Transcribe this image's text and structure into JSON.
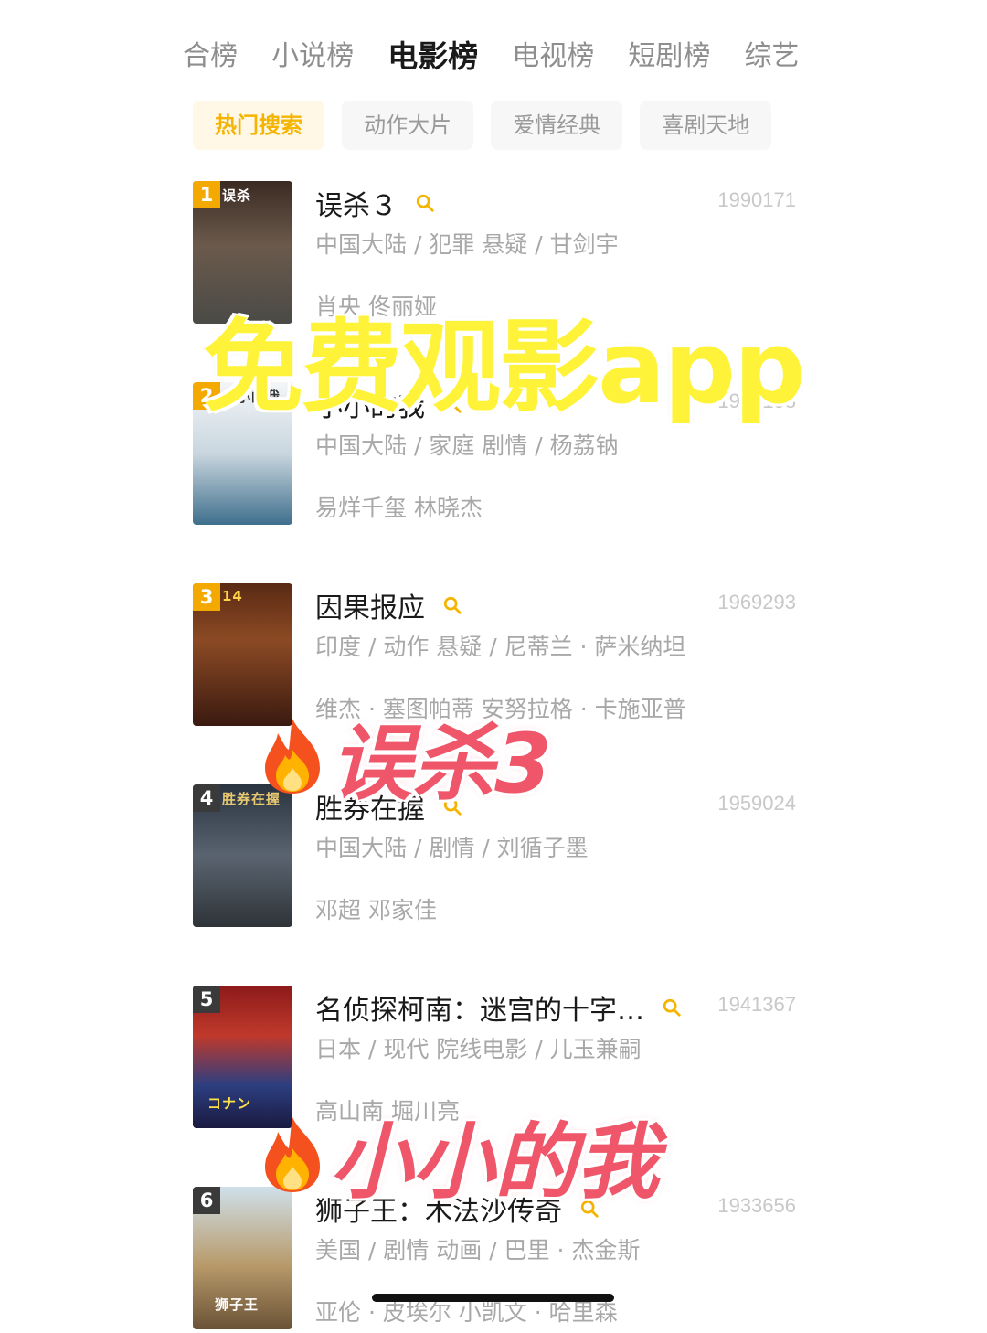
{
  "top_tabs": [
    "合榜",
    "小说榜",
    "电影榜",
    "电视榜",
    "短剧榜",
    "综艺"
  ],
  "active_top_tab": "电影榜",
  "chips": [
    "热门搜索",
    "动作大片",
    "爱情经典",
    "喜剧天地"
  ],
  "active_chip": "热门搜索",
  "list": [
    {
      "rank": "1",
      "title": "误杀３",
      "score": "1990171",
      "meta": "中国大陆 / 犯罪 悬疑 / 甘剑宇",
      "cast": "肖央 佟丽娅",
      "poster_text": "误杀",
      "rank_color": "#f4a900"
    },
    {
      "rank": "2",
      "title": "小小的我",
      "score": "1984158",
      "meta": "中国大陆 / 家庭 剧情 / 杨荔钠",
      "cast": "易烊千玺 林晓杰",
      "poster_text": "小小的我",
      "rank_color": "#f4a900"
    },
    {
      "rank": "3",
      "title": "因果报应",
      "score": "1969293",
      "meta": "印度 / 动作 悬疑 / 尼蒂兰 · 萨米纳坦",
      "cast": "维杰 · 塞图帕蒂 安努拉格 · 卡施亚普",
      "poster_text": "14",
      "rank_color": "#f4a900"
    },
    {
      "rank": "4",
      "title": "胜券在握",
      "score": "1959024",
      "meta": "中国大陆 / 剧情 / 刘循子墨",
      "cast": "邓超 邓家佳",
      "poster_text": "胜券在握",
      "rank_color": "#3a3a3a"
    },
    {
      "rank": "5",
      "title": "名侦探柯南：迷宫的十字…",
      "score": "1941367",
      "meta": "日本 / 现代 院线电影 / 儿玉兼嗣",
      "cast": "高山南 堀川亮",
      "poster_text": "コナン",
      "rank_color": "#3a3a3a"
    },
    {
      "rank": "6",
      "title": "狮子王：木法沙传奇",
      "score": "1933656",
      "meta": "美国 / 剧情 动画 / 巴里 · 杰金斯",
      "cast": "亚伦 · 皮埃尔 小凯文 · 哈里森",
      "poster_text": "狮子王",
      "rank_color": "#3a3a3a"
    }
  ],
  "overlay_text": "免费观影app",
  "fire_tags": [
    "误杀3",
    "小小的我"
  ],
  "colors": {
    "accent": "#f4b400",
    "overlay_yellow": "#fff33a",
    "overlay_pink": "#f0566a"
  }
}
